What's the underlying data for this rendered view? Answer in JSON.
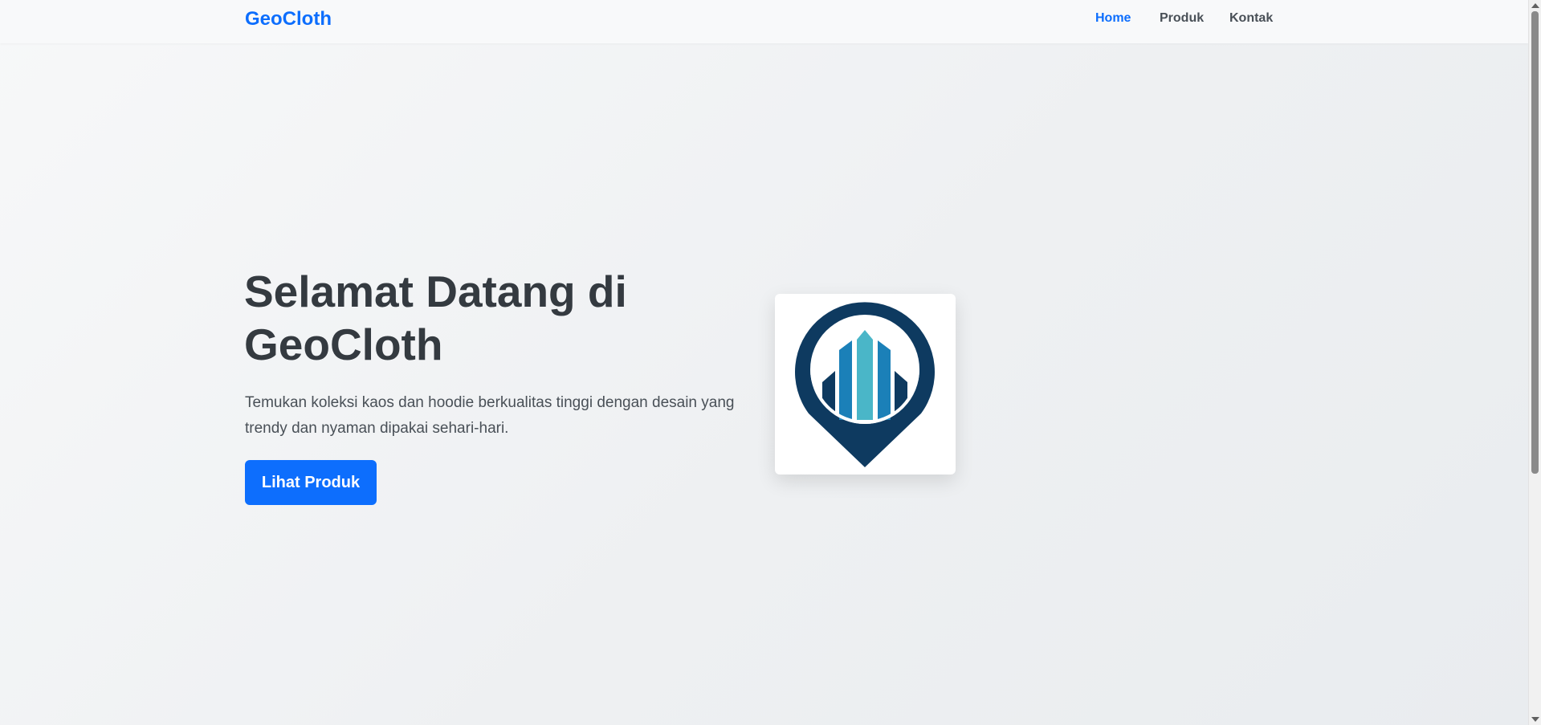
{
  "navbar": {
    "brand": "GeoCloth",
    "links": [
      {
        "label": "Home",
        "active": true
      },
      {
        "label": "Produk",
        "active": false
      },
      {
        "label": "Kontak",
        "active": false
      }
    ]
  },
  "hero": {
    "title": "Selamat Datang di GeoCloth",
    "description": "Temukan koleksi kaos dan hoodie berkualitas tinggi dengan desain yang trendy dan nyaman dipakai sehari-hari.",
    "button_label": "Lihat Produk"
  },
  "logo": {
    "icon": "map-pin-building-logo",
    "colors": {
      "pin": "#0e3a60",
      "bar_mid": "#1b80b8",
      "bar_center": "#4ab6c8"
    }
  },
  "colors": {
    "accent": "#0d6efd",
    "heading": "#343a40",
    "body_text": "#495057"
  }
}
